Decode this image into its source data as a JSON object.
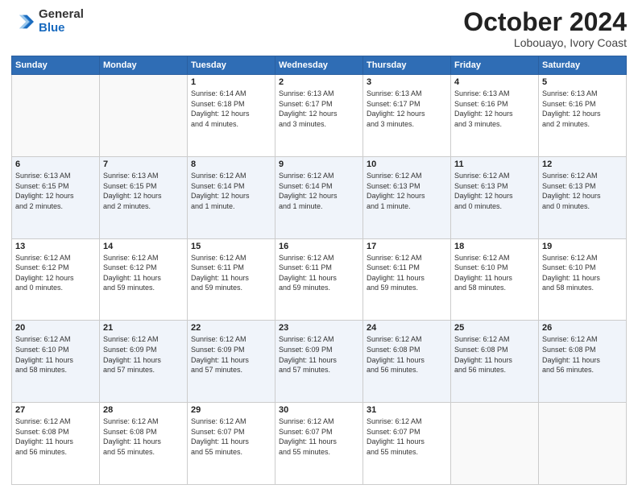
{
  "logo": {
    "general": "General",
    "blue": "Blue"
  },
  "title": "October 2024",
  "subtitle": "Lobouayo, Ivory Coast",
  "weekdays": [
    "Sunday",
    "Monday",
    "Tuesday",
    "Wednesday",
    "Thursday",
    "Friday",
    "Saturday"
  ],
  "weeks": [
    [
      {
        "day": "",
        "info": ""
      },
      {
        "day": "",
        "info": ""
      },
      {
        "day": "1",
        "info": "Sunrise: 6:14 AM\nSunset: 6:18 PM\nDaylight: 12 hours\nand 4 minutes."
      },
      {
        "day": "2",
        "info": "Sunrise: 6:13 AM\nSunset: 6:17 PM\nDaylight: 12 hours\nand 3 minutes."
      },
      {
        "day": "3",
        "info": "Sunrise: 6:13 AM\nSunset: 6:17 PM\nDaylight: 12 hours\nand 3 minutes."
      },
      {
        "day": "4",
        "info": "Sunrise: 6:13 AM\nSunset: 6:16 PM\nDaylight: 12 hours\nand 3 minutes."
      },
      {
        "day": "5",
        "info": "Sunrise: 6:13 AM\nSunset: 6:16 PM\nDaylight: 12 hours\nand 2 minutes."
      }
    ],
    [
      {
        "day": "6",
        "info": "Sunrise: 6:13 AM\nSunset: 6:15 PM\nDaylight: 12 hours\nand 2 minutes."
      },
      {
        "day": "7",
        "info": "Sunrise: 6:13 AM\nSunset: 6:15 PM\nDaylight: 12 hours\nand 2 minutes."
      },
      {
        "day": "8",
        "info": "Sunrise: 6:12 AM\nSunset: 6:14 PM\nDaylight: 12 hours\nand 1 minute."
      },
      {
        "day": "9",
        "info": "Sunrise: 6:12 AM\nSunset: 6:14 PM\nDaylight: 12 hours\nand 1 minute."
      },
      {
        "day": "10",
        "info": "Sunrise: 6:12 AM\nSunset: 6:13 PM\nDaylight: 12 hours\nand 1 minute."
      },
      {
        "day": "11",
        "info": "Sunrise: 6:12 AM\nSunset: 6:13 PM\nDaylight: 12 hours\nand 0 minutes."
      },
      {
        "day": "12",
        "info": "Sunrise: 6:12 AM\nSunset: 6:13 PM\nDaylight: 12 hours\nand 0 minutes."
      }
    ],
    [
      {
        "day": "13",
        "info": "Sunrise: 6:12 AM\nSunset: 6:12 PM\nDaylight: 12 hours\nand 0 minutes."
      },
      {
        "day": "14",
        "info": "Sunrise: 6:12 AM\nSunset: 6:12 PM\nDaylight: 11 hours\nand 59 minutes."
      },
      {
        "day": "15",
        "info": "Sunrise: 6:12 AM\nSunset: 6:11 PM\nDaylight: 11 hours\nand 59 minutes."
      },
      {
        "day": "16",
        "info": "Sunrise: 6:12 AM\nSunset: 6:11 PM\nDaylight: 11 hours\nand 59 minutes."
      },
      {
        "day": "17",
        "info": "Sunrise: 6:12 AM\nSunset: 6:11 PM\nDaylight: 11 hours\nand 59 minutes."
      },
      {
        "day": "18",
        "info": "Sunrise: 6:12 AM\nSunset: 6:10 PM\nDaylight: 11 hours\nand 58 minutes."
      },
      {
        "day": "19",
        "info": "Sunrise: 6:12 AM\nSunset: 6:10 PM\nDaylight: 11 hours\nand 58 minutes."
      }
    ],
    [
      {
        "day": "20",
        "info": "Sunrise: 6:12 AM\nSunset: 6:10 PM\nDaylight: 11 hours\nand 58 minutes."
      },
      {
        "day": "21",
        "info": "Sunrise: 6:12 AM\nSunset: 6:09 PM\nDaylight: 11 hours\nand 57 minutes."
      },
      {
        "day": "22",
        "info": "Sunrise: 6:12 AM\nSunset: 6:09 PM\nDaylight: 11 hours\nand 57 minutes."
      },
      {
        "day": "23",
        "info": "Sunrise: 6:12 AM\nSunset: 6:09 PM\nDaylight: 11 hours\nand 57 minutes."
      },
      {
        "day": "24",
        "info": "Sunrise: 6:12 AM\nSunset: 6:08 PM\nDaylight: 11 hours\nand 56 minutes."
      },
      {
        "day": "25",
        "info": "Sunrise: 6:12 AM\nSunset: 6:08 PM\nDaylight: 11 hours\nand 56 minutes."
      },
      {
        "day": "26",
        "info": "Sunrise: 6:12 AM\nSunset: 6:08 PM\nDaylight: 11 hours\nand 56 minutes."
      }
    ],
    [
      {
        "day": "27",
        "info": "Sunrise: 6:12 AM\nSunset: 6:08 PM\nDaylight: 11 hours\nand 56 minutes."
      },
      {
        "day": "28",
        "info": "Sunrise: 6:12 AM\nSunset: 6:08 PM\nDaylight: 11 hours\nand 55 minutes."
      },
      {
        "day": "29",
        "info": "Sunrise: 6:12 AM\nSunset: 6:07 PM\nDaylight: 11 hours\nand 55 minutes."
      },
      {
        "day": "30",
        "info": "Sunrise: 6:12 AM\nSunset: 6:07 PM\nDaylight: 11 hours\nand 55 minutes."
      },
      {
        "day": "31",
        "info": "Sunrise: 6:12 AM\nSunset: 6:07 PM\nDaylight: 11 hours\nand 55 minutes."
      },
      {
        "day": "",
        "info": ""
      },
      {
        "day": "",
        "info": ""
      }
    ]
  ]
}
